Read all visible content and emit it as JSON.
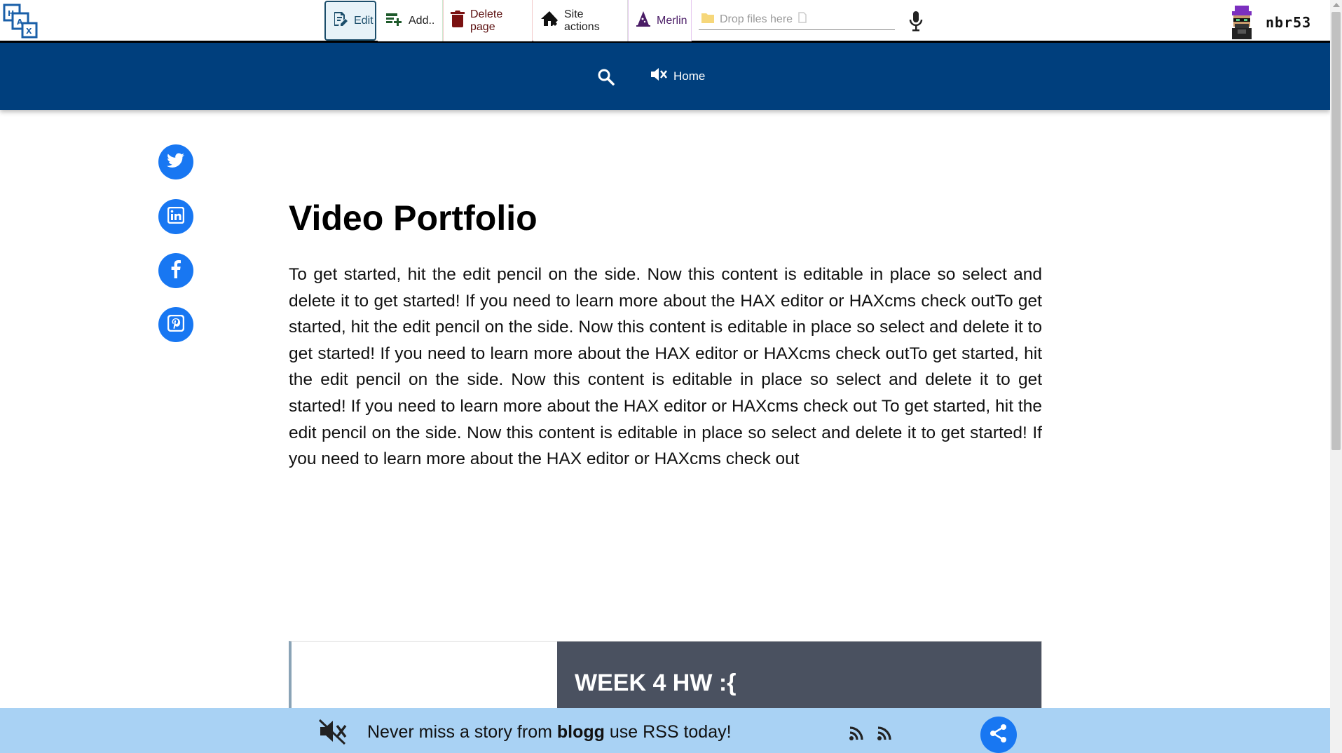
{
  "toolbar": {
    "edit_label": "Edit",
    "add_label": "Add..",
    "delete_label": "Delete page",
    "site_actions_label": "Site actions",
    "merlin_label": "Merlin",
    "drop_placeholder": "Drop files here",
    "username": "nbr53",
    "logo_icon": "hax-logo-icon",
    "mic_icon": "microphone-icon"
  },
  "nav": {
    "search_icon": "search-icon",
    "home_label": "Home",
    "mute_icon": "volume-off-icon",
    "background": "#003f7d"
  },
  "social": [
    {
      "name": "twitter",
      "icon": "twitter-icon"
    },
    {
      "name": "linkedin",
      "icon": "linkedin-icon"
    },
    {
      "name": "facebook",
      "icon": "facebook-icon"
    },
    {
      "name": "pinterest",
      "icon": "pinterest-icon"
    }
  ],
  "page": {
    "title": "Video Portfolio",
    "body": "To get started, hit the edit pencil on the side. Now this content is editable in place so select and delete it to get started! If you need to learn more about the HAX editor or HAXcms check outTo get started, hit the edit pencil on the side. Now this content is editable in place so select and delete it to get started! If you need to learn more about the HAX editor or HAXcms check outTo get started, hit the edit pencil on the side. Now this content is editable in place so select and delete it to get started! If you need to learn more about the HAX editor or HAXcms check out To get started, hit the edit pencil on the side. Now this content is editable in place so select and delete it to get started! If you need to learn more about the HAX editor or HAXcms check out",
    "card_title": "WEEK 4 HW :{"
  },
  "footer": {
    "text_before": "Never miss a story from ",
    "site_name": "blogg",
    "text_after": " use RSS today!",
    "background": "#a9d2f4"
  },
  "colors": {
    "accent_blue": "#1877f2",
    "card_dark": "#4a5160"
  }
}
